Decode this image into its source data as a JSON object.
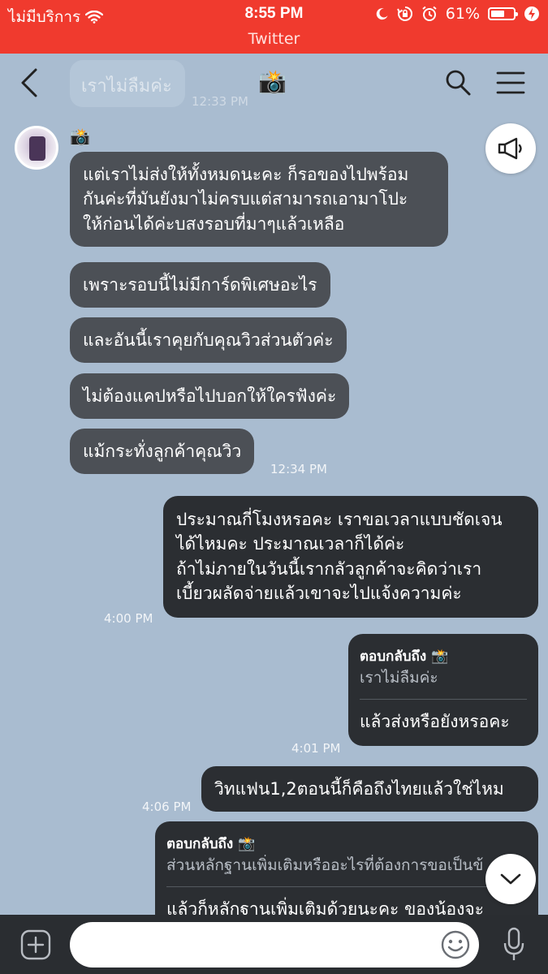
{
  "status_bar": {
    "carrier": "ไม่มีบริการ",
    "time": "8:55 PM",
    "battery": "61%",
    "battery_level": 0.61
  },
  "return_app": "Twitter",
  "header": {
    "title_emoji": "📸",
    "pinned_text": "เราไม่ลืมค่ะ",
    "pinned_time": "12:33 PM"
  },
  "sender": {
    "name_emoji": "📸"
  },
  "messages": [
    {
      "text_lines": [
        "แต่เราไม่ส่งให้ทั้งหมดนะคะ ก็รอของไปพร้อม",
        "กันค่ะที่มันยังมาไม่ครบแต่สามารถเอามาโปะ",
        "ให้ก่อนได้ค่ะบสงรอบที่มาๆแล้วเหลือ"
      ]
    },
    {
      "text": "เพราะรอบนี้ไม่มีการ์ดพิเศษอะไร"
    },
    {
      "text": "และอันนี้เราคุยกับคุณวิวส่วนตัวค่ะ"
    },
    {
      "text": "ไม่ต้องแคปหรือไปบอกให้ใครฟังค่ะ"
    },
    {
      "text": "แม้กระทั่งลูกค้าคุณวิว",
      "time": "12:34 PM"
    },
    {
      "text_lines": [
        "ประมาณกี่โมงหรอคะ เราขอเวลาแบบชัดเจน",
        "ได้ไหมคะ ประมาณเวลาก็ได้ค่ะ",
        "ถ้าไม่ภายในวันนี้เรากลัวลูกค้าจะคิดว่าเรา",
        "เบี้ยวผลัดจ่ายแล้วเขาจะไปแจ้งความค่ะ"
      ],
      "time": "4:00 PM"
    },
    {
      "reply_label": "ตอบกลับถึง 📸",
      "quoted": "เราไม่ลืมค่ะ",
      "text": "แล้วส่งหรือยังหรอคะ",
      "time": "4:01 PM"
    },
    {
      "text": "วิทแฟน1,2ตอนนี้ก็คือถึงไทยแล้วใช่ไหม",
      "time": "4:06 PM"
    },
    {
      "reply_label": "ตอบกลับถึง 📸",
      "quoted": "ส่วนหลักฐานเพิ่มเติมหรืออะไรที่ต้องการขอเป็นข้",
      "text": "แล้วก็หลักฐานเพิ่มเติมด้วยนะคะ ของน้องจะ"
    }
  ],
  "input": {
    "placeholder": ""
  },
  "colors": {
    "status_red": "#f03a2e",
    "chat_background": "#a9bcd0",
    "incoming_bubble": "#4c5056",
    "outgoing_bubble": "#2b2e32",
    "input_bar": "#2a2d31"
  },
  "icons": [
    "wifi-icon",
    "moon-icon",
    "lock-rotation-icon",
    "alarm-icon",
    "battery-icon",
    "back-icon",
    "search-icon",
    "menu-icon",
    "megaphone-icon",
    "chevron-down-icon",
    "add-icon",
    "emoji-icon",
    "microphone-icon"
  ]
}
